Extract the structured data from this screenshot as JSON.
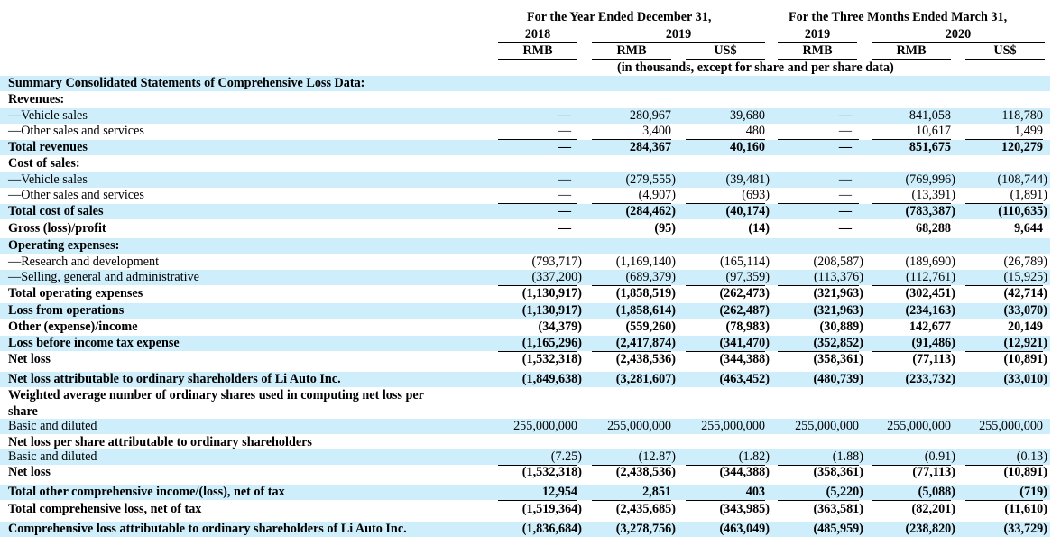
{
  "header": {
    "group_year": "For the Year Ended December 31,",
    "group_quarter": "For the Three Months Ended March 31,",
    "years": [
      "2018",
      "2019",
      "2019",
      "2020"
    ],
    "currencies": [
      "RMB",
      "RMB",
      "US$",
      "RMB",
      "RMB",
      "US$"
    ],
    "units_note": "(in thousands, except for share and per share data)"
  },
  "rows": [
    {
      "label": "Summary Consolidated Statements of Comprehensive Loss Data:",
      "bold": true,
      "shade": true,
      "values": []
    },
    {
      "label": "Revenues:",
      "bold": true,
      "shade": false,
      "values": []
    },
    {
      "label": "—Vehicle sales",
      "bold": false,
      "shade": true,
      "values": [
        "—",
        "280,967",
        "39,680",
        "—",
        "841,058",
        "118,780"
      ]
    },
    {
      "label": "—Other sales and services",
      "bold": false,
      "shade": false,
      "values": [
        "—",
        "3,400",
        "480",
        "—",
        "10,617",
        "1,499"
      ]
    },
    {
      "label": "Total revenues",
      "bold": true,
      "shade": true,
      "values": [
        "—",
        "284,367",
        "40,160",
        "—",
        "851,675",
        "120,279"
      ]
    },
    {
      "label": "Cost of sales:",
      "bold": true,
      "shade": false,
      "values": []
    },
    {
      "label": "—Vehicle sales",
      "bold": false,
      "shade": true,
      "values": [
        "—",
        "(279,555)",
        "(39,481)",
        "—",
        "(769,996)",
        "(108,744)"
      ]
    },
    {
      "label": "—Other sales and services",
      "bold": false,
      "shade": false,
      "values": [
        "—",
        "(4,907)",
        "(693)",
        "—",
        "(13,391)",
        "(1,891)"
      ]
    },
    {
      "label": "Total cost of sales",
      "bold": true,
      "shade": true,
      "values": [
        "—",
        "(284,462)",
        "(40,174)",
        "—",
        "(783,387)",
        "(110,635)"
      ]
    },
    {
      "label": "Gross (loss)/profit",
      "bold": true,
      "shade": false,
      "values": [
        "—",
        "(95)",
        "(14)",
        "—",
        "68,288",
        "9,644"
      ]
    },
    {
      "label": "Operating expenses:",
      "bold": true,
      "shade": true,
      "values": []
    },
    {
      "label": "—Research and development",
      "bold": false,
      "shade": false,
      "values": [
        "(793,717)",
        "(1,169,140)",
        "(165,114)",
        "(208,587)",
        "(189,690)",
        "(26,789)"
      ]
    },
    {
      "label": "—Selling, general and administrative",
      "bold": false,
      "shade": true,
      "values": [
        "(337,200)",
        "(689,379)",
        "(97,359)",
        "(113,376)",
        "(112,761)",
        "(15,925)"
      ]
    },
    {
      "label": "Total operating expenses",
      "bold": true,
      "shade": false,
      "values": [
        "(1,130,917)",
        "(1,858,519)",
        "(262,473)",
        "(321,963)",
        "(302,451)",
        "(42,714)"
      ]
    },
    {
      "label": "Loss from operations",
      "bold": true,
      "shade": true,
      "values": [
        "(1,130,917)",
        "(1,858,614)",
        "(262,487)",
        "(321,963)",
        "(234,163)",
        "(33,070)"
      ]
    },
    {
      "label": "Other (expense)/income",
      "bold": true,
      "shade": false,
      "values": [
        "(34,379)",
        "(559,260)",
        "(78,983)",
        "(30,889)",
        "142,677",
        "20,149"
      ]
    },
    {
      "label": "Loss before income tax expense",
      "bold": true,
      "shade": true,
      "values": [
        "(1,165,296)",
        "(2,417,874)",
        "(341,470)",
        "(352,852)",
        "(91,486)",
        "(12,921)"
      ]
    },
    {
      "label": "Net loss",
      "bold": true,
      "shade": false,
      "values": [
        "(1,532,318)",
        "(2,438,536)",
        "(344,388)",
        "(358,361)",
        "(77,113)",
        "(10,891)"
      ]
    },
    {
      "label": "Net loss attributable to ordinary shareholders of Li Auto Inc.",
      "bold": true,
      "shade": true,
      "values": [
        "(1,849,638)",
        "(3,281,607)",
        "(463,452)",
        "(480,739)",
        "(233,732)",
        "(33,010)"
      ]
    },
    {
      "label": "Weighted average number of ordinary shares used in computing net loss per",
      "bold": true,
      "shade": false,
      "values": []
    },
    {
      "label": "share",
      "bold": true,
      "shade": false,
      "values": []
    },
    {
      "label": "Basic and diluted",
      "bold": false,
      "shade": true,
      "values": [
        "255,000,000",
        "255,000,000",
        "255,000,000",
        "255,000,000",
        "255,000,000",
        "255,000,000"
      ]
    },
    {
      "label": "Net loss per share attributable to ordinary shareholders",
      "bold": true,
      "shade": false,
      "values": []
    },
    {
      "label": "Basic and diluted",
      "bold": false,
      "shade": true,
      "values": [
        "(7.25)",
        "(12.87)",
        "(1.82)",
        "(1.88)",
        "(0.91)",
        "(0.13)"
      ]
    },
    {
      "label": "Net loss",
      "bold": true,
      "shade": false,
      "values": [
        "(1,532,318)",
        "(2,438,536)",
        "(344,388)",
        "(358,361)",
        "(77,113)",
        "(10,891)"
      ]
    },
    {
      "label": "Total other comprehensive income/(loss), net of tax",
      "bold": true,
      "shade": true,
      "values": [
        "12,954",
        "2,851",
        "403",
        "(5,220)",
        "(5,088)",
        "(719)"
      ]
    },
    {
      "label": "Total comprehensive loss, net of tax",
      "bold": true,
      "shade": false,
      "values": [
        "(1,519,364)",
        "(2,435,685)",
        "(343,985)",
        "(363,581)",
        "(82,201)",
        "(11,610)"
      ]
    },
    {
      "label": "Comprehensive loss attributable to ordinary shareholders of Li Auto Inc.",
      "bold": true,
      "shade": true,
      "values": [
        "(1,836,684)",
        "(3,278,756)",
        "(463,049)",
        "(485,959)",
        "(238,820)",
        "(33,729)"
      ]
    }
  ]
}
